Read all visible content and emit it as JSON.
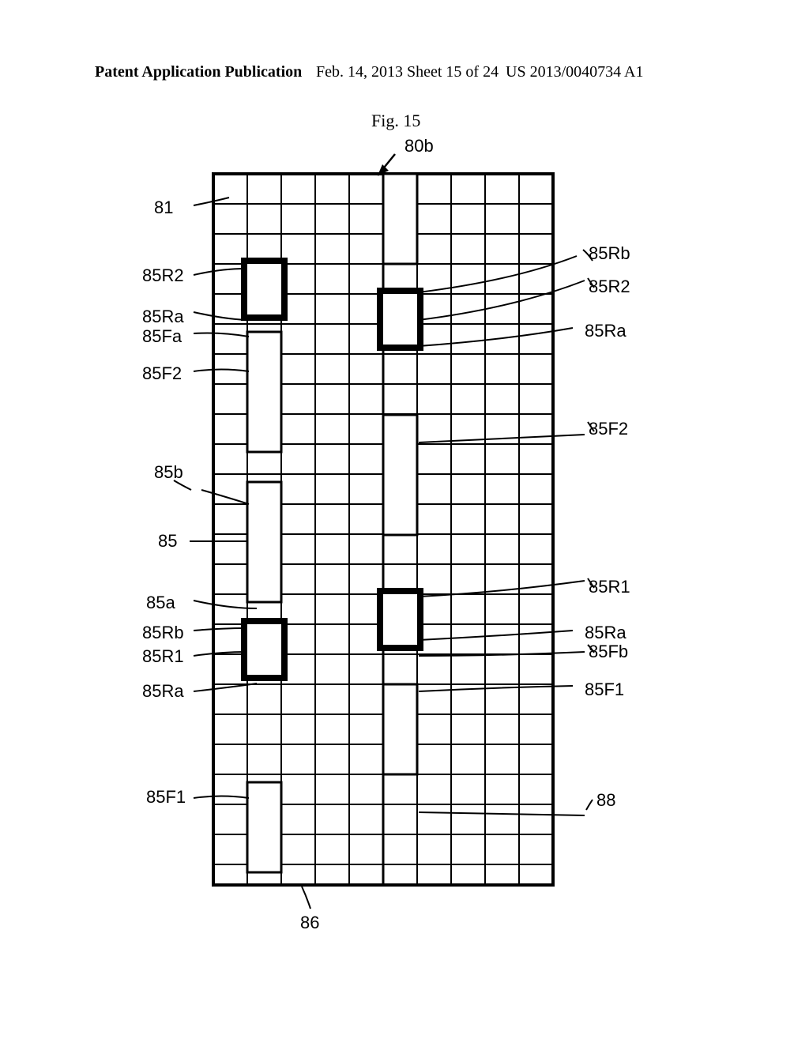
{
  "header": {
    "left": "Patent Application Publication",
    "center": "Feb. 14, 2013  Sheet 15 of 24",
    "right": "US 2013/0040734 A1"
  },
  "figure": {
    "title": "Fig. 15",
    "top_ref": "80b",
    "bottom_ref": "86"
  },
  "labels_left": {
    "l1": "81",
    "l2": "85R2",
    "l3": "85Ra",
    "l4": "85Fa",
    "l5": "85F2",
    "l6": "85b",
    "l7": "85",
    "l8": "85a",
    "l9": "85Rb",
    "l10": "85R1",
    "l11": "85Ra",
    "l12": "85F1"
  },
  "labels_right": {
    "r1": "85Rb",
    "r2": "85R2",
    "r3": "85Ra",
    "r4": "85F2",
    "r5": "85R1",
    "r6": "85Ra",
    "r7": "85Fb",
    "r8": "85F1",
    "r9": "88"
  }
}
